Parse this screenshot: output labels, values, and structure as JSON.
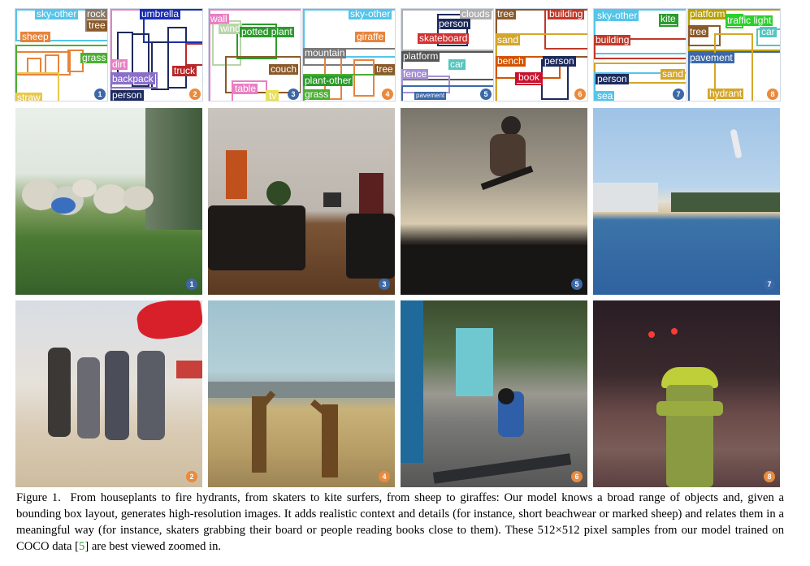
{
  "figure": {
    "caption": {
      "label": "Figure 1.",
      "text_before_ref": "From houseplants to fire hydrants, from skaters to kite surfers, from sheep to giraffes: Our model knows a broad range of objects and, given a bounding box layout, generates high-resolution images. It adds realistic context and details (for instance, short beachwear or marked sheep) and relates them in a meaningful way (for instance, skaters grabbing their board or people reading books close to them). These 512×512 pixel samples from our model trained on COCO data [",
      "ref": "5",
      "text_after_ref": "] are best viewed zoomed in."
    },
    "layouts": [
      {
        "number": "1",
        "badge_color": "#3c68a8",
        "labels": [
          {
            "text": "sky-other",
            "color": "#55c5ea"
          },
          {
            "text": "rock",
            "color": "#8a7a6a"
          },
          {
            "text": "tree",
            "color": "#8b5a2b"
          },
          {
            "text": "sheep",
            "color": "#e6843c"
          },
          {
            "text": "grass",
            "color": "#4caf32"
          },
          {
            "text": "straw",
            "color": "#e8c84a"
          }
        ]
      },
      {
        "number": "2",
        "badge_color": "#e98a3d",
        "labels": [
          {
            "text": "umbrella",
            "color": "#1b2fb0"
          },
          {
            "text": "dirt",
            "color": "#e97fc3"
          },
          {
            "text": "backpack",
            "color": "#8a6fc8"
          },
          {
            "text": "truck",
            "color": "#b8282a"
          },
          {
            "text": "person",
            "color": "#1d2a5c"
          }
        ]
      },
      {
        "number": "3",
        "badge_color": "#3c68a8",
        "labels": [
          {
            "text": "wall",
            "color": "#e97fc3"
          },
          {
            "text": "wind",
            "color": "#b8d6a8"
          },
          {
            "text": "potted plant",
            "color": "#2c9b2c"
          },
          {
            "text": "couch",
            "color": "#8b5a2b"
          },
          {
            "text": "table",
            "color": "#e97fc3"
          },
          {
            "text": "tv",
            "color": "#e8e05a"
          }
        ]
      },
      {
        "number": "4",
        "badge_color": "#e98a3d",
        "labels": [
          {
            "text": "sky-other",
            "color": "#55c5ea"
          },
          {
            "text": "giraffe",
            "color": "#e6843c"
          },
          {
            "text": "mountain",
            "color": "#7a7a7a"
          },
          {
            "text": "tree",
            "color": "#8b5a2b"
          },
          {
            "text": "plant-other",
            "color": "#2c9b2c"
          },
          {
            "text": "grass",
            "color": "#4caf32"
          }
        ]
      },
      {
        "number": "5",
        "badge_color": "#3c68a8",
        "labels": [
          {
            "text": "clouds",
            "color": "#b0b0b0"
          },
          {
            "text": "person",
            "color": "#1d2a5c"
          },
          {
            "text": "skateboard",
            "color": "#d42f2f"
          },
          {
            "text": "platform",
            "color": "#555555"
          },
          {
            "text": "car",
            "color": "#55c5c0"
          },
          {
            "text": "fence",
            "color": "#a58fd2"
          },
          {
            "text": "pavement",
            "color": "#3c68a8"
          }
        ]
      },
      {
        "number": "6",
        "badge_color": "#e98a3d",
        "labels": [
          {
            "text": "tree",
            "color": "#8b5a2b"
          },
          {
            "text": "building",
            "color": "#c0392b"
          },
          {
            "text": "sand",
            "color": "#d4a62a"
          },
          {
            "text": "bench",
            "color": "#d35400"
          },
          {
            "text": "person",
            "color": "#1d2a5c"
          },
          {
            "text": "book",
            "color": "#c8102e"
          }
        ]
      },
      {
        "number": "7",
        "badge_color": "#3c68a8",
        "labels": [
          {
            "text": "sky-other",
            "color": "#55c5ea"
          },
          {
            "text": "kite",
            "color": "#2c9b2c"
          },
          {
            "text": "building",
            "color": "#c0392b"
          },
          {
            "text": "person",
            "color": "#1d2a5c"
          },
          {
            "text": "sand",
            "color": "#d4a62a"
          },
          {
            "text": "sea",
            "color": "#55c5ea"
          }
        ]
      },
      {
        "number": "8",
        "badge_color": "#e98a3d",
        "labels": [
          {
            "text": "platform",
            "color": "#b8a000"
          },
          {
            "text": "traffic light",
            "color": "#2ccf2c"
          },
          {
            "text": "tree",
            "color": "#8b5a2b"
          },
          {
            "text": "car",
            "color": "#55c5c0"
          },
          {
            "text": "pavement",
            "color": "#3c68a8"
          },
          {
            "text": "hydrant",
            "color": "#d4a62a"
          }
        ]
      }
    ],
    "photos": [
      {
        "number": "1",
        "badge_color": "#3c68a8"
      },
      {
        "number": "3",
        "badge_color": "#3c68a8"
      },
      {
        "number": "5",
        "badge_color": "#3c68a8"
      },
      {
        "number": "7",
        "badge_color": "#3c68a8"
      },
      {
        "number": "2",
        "badge_color": "#e98a3d"
      },
      {
        "number": "4",
        "badge_color": "#e98a3d"
      },
      {
        "number": "6",
        "badge_color": "#e98a3d"
      },
      {
        "number": "8",
        "badge_color": "#e98a3d"
      }
    ]
  }
}
